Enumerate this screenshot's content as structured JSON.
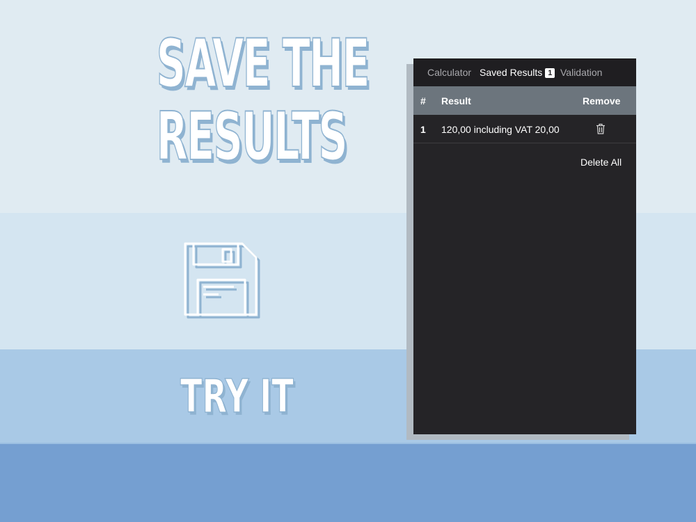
{
  "headline": {
    "line1": "SAVE THE",
    "line2": "RESULTS"
  },
  "cta": {
    "label": "TRY IT"
  },
  "icons": {
    "hero": "floppy-disk-icon",
    "remove": "trash-icon"
  },
  "colors": {
    "band_top": "#e0ebf2",
    "band_mid": "#d4e5f1",
    "band_lower": "#a9c9e6",
    "band_bottom": "#759fd1",
    "panel_bg": "#252427",
    "table_header_bg": "#6c757d",
    "text_outline": "#8fb3d1"
  },
  "panel": {
    "tabs": [
      {
        "label": "Calculator",
        "active": false
      },
      {
        "label": "Saved Results",
        "active": true,
        "badge": "1"
      },
      {
        "label": "Validation",
        "active": false
      }
    ],
    "table": {
      "headers": {
        "index": "#",
        "result": "Result",
        "remove": "Remove"
      },
      "rows": [
        {
          "index": "1",
          "result": "120,00 including VAT 20,00"
        }
      ]
    },
    "delete_all_label": "Delete All"
  }
}
